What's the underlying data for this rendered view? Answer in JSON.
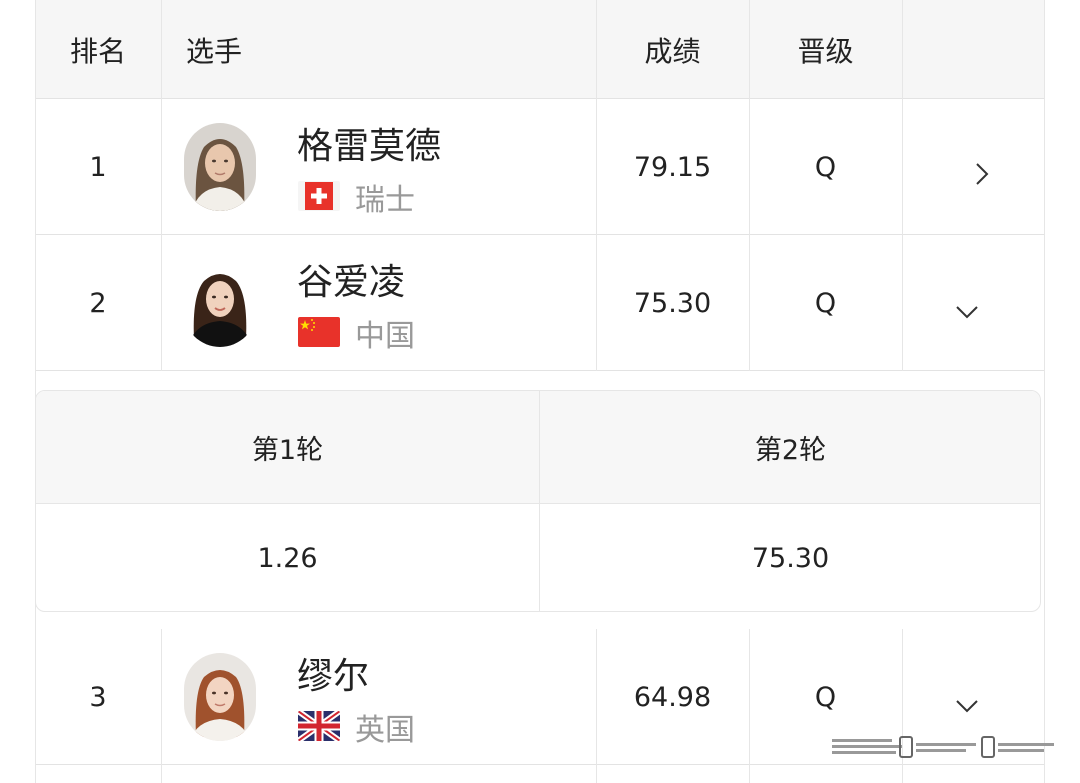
{
  "header": {
    "rank": "排名",
    "player": "选手",
    "score": "成绩",
    "qualify": "晋级"
  },
  "rows": [
    {
      "rank": "1",
      "name": "格雷莫德",
      "country": "瑞士",
      "score": "79.15",
      "qualify": "Q",
      "chevron": "chevron-right-icon"
    },
    {
      "rank": "2",
      "name": "谷爱凌",
      "country": "中国",
      "score": "75.30",
      "qualify": "Q",
      "chevron": "chevron-down-icon"
    },
    {
      "rank": "3",
      "name": "缪尔",
      "country": "英国",
      "score": "64.98",
      "qualify": "Q",
      "chevron": "chevron-down-icon"
    }
  ],
  "detail": {
    "round1_label": "第1轮",
    "round2_label": "第2轮",
    "round1_score": "1.26",
    "round2_score": "75.30"
  },
  "colors": {
    "header_bg": "#f6f6f6",
    "border": "#e6e6e6",
    "muted_text": "#999999",
    "flag_red": "#e8322a",
    "flag_yellow": "#ffde00",
    "uk_blue": "#2a2f6b"
  }
}
